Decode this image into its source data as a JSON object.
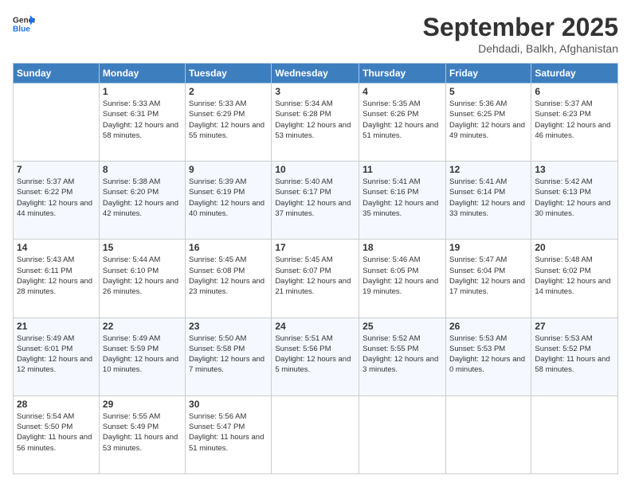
{
  "logo": {
    "line1": "General",
    "line2": "Blue"
  },
  "title": "September 2025",
  "location": "Dehdadi, Balkh, Afghanistan",
  "weekdays": [
    "Sunday",
    "Monday",
    "Tuesday",
    "Wednesday",
    "Thursday",
    "Friday",
    "Saturday"
  ],
  "weeks": [
    [
      {
        "day": "",
        "info": ""
      },
      {
        "day": "1",
        "info": "Sunrise: 5:33 AM\nSunset: 6:31 PM\nDaylight: 12 hours\nand 58 minutes."
      },
      {
        "day": "2",
        "info": "Sunrise: 5:33 AM\nSunset: 6:29 PM\nDaylight: 12 hours\nand 55 minutes."
      },
      {
        "day": "3",
        "info": "Sunrise: 5:34 AM\nSunset: 6:28 PM\nDaylight: 12 hours\nand 53 minutes."
      },
      {
        "day": "4",
        "info": "Sunrise: 5:35 AM\nSunset: 6:26 PM\nDaylight: 12 hours\nand 51 minutes."
      },
      {
        "day": "5",
        "info": "Sunrise: 5:36 AM\nSunset: 6:25 PM\nDaylight: 12 hours\nand 49 minutes."
      },
      {
        "day": "6",
        "info": "Sunrise: 5:37 AM\nSunset: 6:23 PM\nDaylight: 12 hours\nand 46 minutes."
      }
    ],
    [
      {
        "day": "7",
        "info": "Sunrise: 5:37 AM\nSunset: 6:22 PM\nDaylight: 12 hours\nand 44 minutes."
      },
      {
        "day": "8",
        "info": "Sunrise: 5:38 AM\nSunset: 6:20 PM\nDaylight: 12 hours\nand 42 minutes."
      },
      {
        "day": "9",
        "info": "Sunrise: 5:39 AM\nSunset: 6:19 PM\nDaylight: 12 hours\nand 40 minutes."
      },
      {
        "day": "10",
        "info": "Sunrise: 5:40 AM\nSunset: 6:17 PM\nDaylight: 12 hours\nand 37 minutes."
      },
      {
        "day": "11",
        "info": "Sunrise: 5:41 AM\nSunset: 6:16 PM\nDaylight: 12 hours\nand 35 minutes."
      },
      {
        "day": "12",
        "info": "Sunrise: 5:41 AM\nSunset: 6:14 PM\nDaylight: 12 hours\nand 33 minutes."
      },
      {
        "day": "13",
        "info": "Sunrise: 5:42 AM\nSunset: 6:13 PM\nDaylight: 12 hours\nand 30 minutes."
      }
    ],
    [
      {
        "day": "14",
        "info": "Sunrise: 5:43 AM\nSunset: 6:11 PM\nDaylight: 12 hours\nand 28 minutes."
      },
      {
        "day": "15",
        "info": "Sunrise: 5:44 AM\nSunset: 6:10 PM\nDaylight: 12 hours\nand 26 minutes."
      },
      {
        "day": "16",
        "info": "Sunrise: 5:45 AM\nSunset: 6:08 PM\nDaylight: 12 hours\nand 23 minutes."
      },
      {
        "day": "17",
        "info": "Sunrise: 5:45 AM\nSunset: 6:07 PM\nDaylight: 12 hours\nand 21 minutes."
      },
      {
        "day": "18",
        "info": "Sunrise: 5:46 AM\nSunset: 6:05 PM\nDaylight: 12 hours\nand 19 minutes."
      },
      {
        "day": "19",
        "info": "Sunrise: 5:47 AM\nSunset: 6:04 PM\nDaylight: 12 hours\nand 17 minutes."
      },
      {
        "day": "20",
        "info": "Sunrise: 5:48 AM\nSunset: 6:02 PM\nDaylight: 12 hours\nand 14 minutes."
      }
    ],
    [
      {
        "day": "21",
        "info": "Sunrise: 5:49 AM\nSunset: 6:01 PM\nDaylight: 12 hours\nand 12 minutes."
      },
      {
        "day": "22",
        "info": "Sunrise: 5:49 AM\nSunset: 5:59 PM\nDaylight: 12 hours\nand 10 minutes."
      },
      {
        "day": "23",
        "info": "Sunrise: 5:50 AM\nSunset: 5:58 PM\nDaylight: 12 hours\nand 7 minutes."
      },
      {
        "day": "24",
        "info": "Sunrise: 5:51 AM\nSunset: 5:56 PM\nDaylight: 12 hours\nand 5 minutes."
      },
      {
        "day": "25",
        "info": "Sunrise: 5:52 AM\nSunset: 5:55 PM\nDaylight: 12 hours\nand 3 minutes."
      },
      {
        "day": "26",
        "info": "Sunrise: 5:53 AM\nSunset: 5:53 PM\nDaylight: 12 hours\nand 0 minutes."
      },
      {
        "day": "27",
        "info": "Sunrise: 5:53 AM\nSunset: 5:52 PM\nDaylight: 11 hours\nand 58 minutes."
      }
    ],
    [
      {
        "day": "28",
        "info": "Sunrise: 5:54 AM\nSunset: 5:50 PM\nDaylight: 11 hours\nand 56 minutes."
      },
      {
        "day": "29",
        "info": "Sunrise: 5:55 AM\nSunset: 5:49 PM\nDaylight: 11 hours\nand 53 minutes."
      },
      {
        "day": "30",
        "info": "Sunrise: 5:56 AM\nSunset: 5:47 PM\nDaylight: 11 hours\nand 51 minutes."
      },
      {
        "day": "",
        "info": ""
      },
      {
        "day": "",
        "info": ""
      },
      {
        "day": "",
        "info": ""
      },
      {
        "day": "",
        "info": ""
      }
    ]
  ]
}
